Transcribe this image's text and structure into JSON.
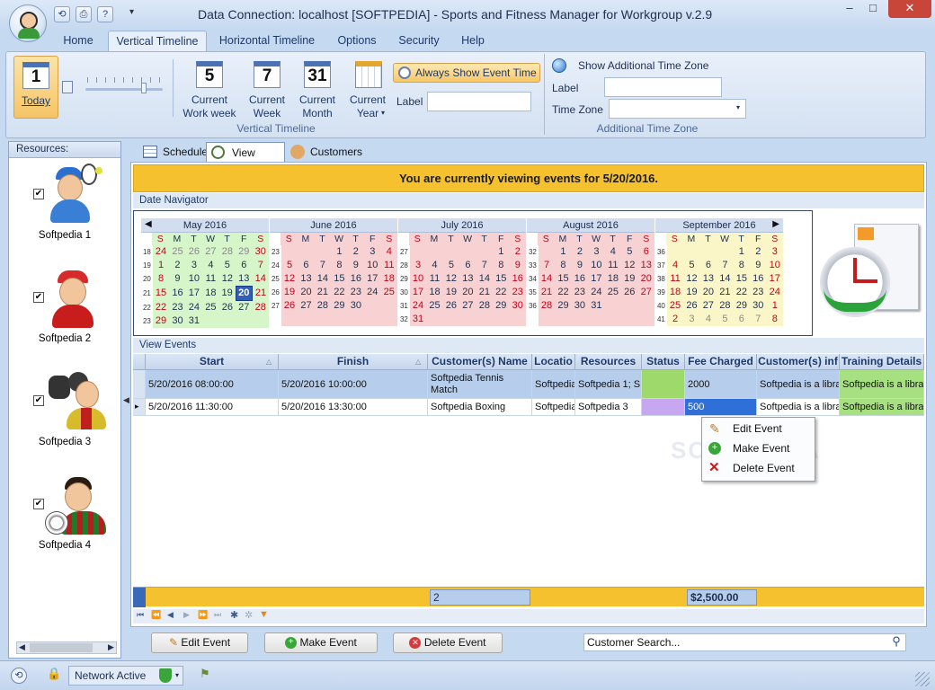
{
  "window": {
    "title": "Data Connection: localhost [SOFTPEDIA] - Sports and Fitness Manager for Workgroup v.2.9",
    "minimize": "–",
    "maximize": "□",
    "close": "✕"
  },
  "ribbon": {
    "tabs": [
      "Home",
      "Vertical Timeline",
      "Horizontal Timeline",
      "Options",
      "Security",
      "Help"
    ],
    "active_tab": "Vertical Timeline",
    "vertical_timeline": {
      "today": {
        "icon_text": "1",
        "label": "Today"
      },
      "current_work_week": {
        "icon_text": "5",
        "label_line1": "Current",
        "label_line2": "Work week"
      },
      "current_week": {
        "icon_text": "7",
        "label_line1": "Current",
        "label_line2": "Week"
      },
      "current_month": {
        "icon_text": "31",
        "label_line1": "Current",
        "label_line2": "Month"
      },
      "current_year": {
        "label_line1": "Current",
        "label_line2": "Year"
      },
      "always_show_event_time": "Always Show Event Time",
      "label_field": {
        "label": "Label",
        "value": ""
      },
      "group_label": "Vertical Timeline"
    },
    "additional_time_zone": {
      "show_label": "Show Additional Time Zone",
      "label_label": "Label",
      "label_value": "",
      "time_zone_label": "Time Zone",
      "time_zone_value": "",
      "group_label": "Additional Time Zone"
    }
  },
  "resources": {
    "header": "Resources:",
    "items": [
      {
        "name": "Softpedia 1",
        "checked": true
      },
      {
        "name": "Softpedia 2",
        "checked": true
      },
      {
        "name": "Softpedia 3",
        "checked": true
      },
      {
        "name": "Softpedia 4",
        "checked": true
      }
    ]
  },
  "content_tabs": [
    "Scheduler",
    "View Events",
    "Customers"
  ],
  "active_content_tab": "View Events",
  "banner": "You are currently viewing events for 5/20/2016.",
  "date_navigator": {
    "label": "Date Navigator",
    "dow": [
      "S",
      "M",
      "T",
      "W",
      "T",
      "F",
      "S"
    ],
    "months": [
      {
        "name": "May 2016",
        "watermark": "5",
        "bg": "#d6f5c8",
        "nav_prev": "◀",
        "weeks": [
          {
            "wk": "18",
            "days": [
              "24",
              "25",
              "26",
              "27",
              "28",
              "29",
              "30"
            ],
            "kinds": [
              "po",
              "po",
              "po",
              "po",
              "po",
              "po",
              "po"
            ]
          },
          {
            "wk": "19",
            "days": [
              "1",
              "2",
              "3",
              "4",
              "5",
              "6",
              "7"
            ]
          },
          {
            "wk": "20",
            "days": [
              "8",
              "9",
              "10",
              "11",
              "12",
              "13",
              "14"
            ]
          },
          {
            "wk": "21",
            "days": [
              "15",
              "16",
              "17",
              "18",
              "19",
              "20",
              "21"
            ],
            "selected": "20"
          },
          {
            "wk": "22",
            "days": [
              "22",
              "23",
              "24",
              "25",
              "26",
              "27",
              "28"
            ]
          },
          {
            "wk": "23",
            "days": [
              "29",
              "30",
              "31",
              "",
              "",
              "",
              ""
            ]
          }
        ]
      },
      {
        "name": "June 2016",
        "watermark": "6",
        "bg": "#f8d2d2",
        "weeks": [
          {
            "wk": "23",
            "days": [
              "",
              "",
              "",
              "1",
              "2",
              "3",
              "4"
            ]
          },
          {
            "wk": "24",
            "days": [
              "5",
              "6",
              "7",
              "8",
              "9",
              "10",
              "11"
            ]
          },
          {
            "wk": "25",
            "days": [
              "12",
              "13",
              "14",
              "15",
              "16",
              "17",
              "18"
            ]
          },
          {
            "wk": "26",
            "days": [
              "19",
              "20",
              "21",
              "22",
              "23",
              "24",
              "25"
            ]
          },
          {
            "wk": "27",
            "days": [
              "26",
              "27",
              "28",
              "29",
              "30",
              "",
              ""
            ]
          },
          {
            "wk": "",
            "days": [
              "",
              "",
              "",
              "",
              "",
              "",
              ""
            ]
          }
        ]
      },
      {
        "name": "July 2016",
        "watermark": "7",
        "bg": "#f8d2d2",
        "weeks": [
          {
            "wk": "27",
            "days": [
              "",
              "",
              "",
              "",
              "",
              "1",
              "2"
            ]
          },
          {
            "wk": "28",
            "days": [
              "3",
              "4",
              "5",
              "6",
              "7",
              "8",
              "9"
            ]
          },
          {
            "wk": "29",
            "days": [
              "10",
              "11",
              "12",
              "13",
              "14",
              "15",
              "16"
            ]
          },
          {
            "wk": "30",
            "days": [
              "17",
              "18",
              "19",
              "20",
              "21",
              "22",
              "23"
            ]
          },
          {
            "wk": "31",
            "days": [
              "24",
              "25",
              "26",
              "27",
              "28",
              "29",
              "30"
            ]
          },
          {
            "wk": "32",
            "days": [
              "31",
              "",
              "",
              "",
              "",
              "",
              ""
            ]
          }
        ]
      },
      {
        "name": "August 2016",
        "watermark": "8",
        "bg": "#f8d2d2",
        "weeks": [
          {
            "wk": "32",
            "days": [
              "",
              "1",
              "2",
              "3",
              "4",
              "5",
              "6"
            ]
          },
          {
            "wk": "33",
            "days": [
              "7",
              "8",
              "9",
              "10",
              "11",
              "12",
              "13"
            ]
          },
          {
            "wk": "34",
            "days": [
              "14",
              "15",
              "16",
              "17",
              "18",
              "19",
              "20"
            ]
          },
          {
            "wk": "35",
            "days": [
              "21",
              "22",
              "23",
              "24",
              "25",
              "26",
              "27"
            ]
          },
          {
            "wk": "36",
            "days": [
              "28",
              "29",
              "30",
              "31",
              "",
              "",
              ""
            ]
          },
          {
            "wk": "",
            "days": [
              "",
              "",
              "",
              "",
              "",
              "",
              ""
            ]
          }
        ]
      },
      {
        "name": "September 2016",
        "watermark": "9",
        "bg": "#fbf6c8",
        "nav_next": "▶",
        "weeks": [
          {
            "wk": "36",
            "days": [
              "",
              "",
              "",
              "",
              "1",
              "2",
              "3"
            ]
          },
          {
            "wk": "37",
            "days": [
              "4",
              "5",
              "6",
              "7",
              "8",
              "9",
              "10"
            ]
          },
          {
            "wk": "38",
            "days": [
              "11",
              "12",
              "13",
              "14",
              "15",
              "16",
              "17"
            ]
          },
          {
            "wk": "39",
            "days": [
              "18",
              "19",
              "20",
              "21",
              "22",
              "23",
              "24"
            ]
          },
          {
            "wk": "40",
            "days": [
              "25",
              "26",
              "27",
              "28",
              "29",
              "30",
              "1"
            ],
            "kinds": [
              "",
              "",
              "",
              "",
              "",
              "",
              "po"
            ]
          },
          {
            "wk": "41",
            "days": [
              "2",
              "3",
              "4",
              "5",
              "6",
              "7",
              "8"
            ],
            "kinds": [
              "po",
              "po",
              "po",
              "po",
              "po",
              "po",
              "po"
            ]
          }
        ]
      }
    ]
  },
  "view_events": {
    "label": "View Events",
    "columns": [
      "Start",
      "Finish",
      "Customer(s) Name",
      "Locatio",
      "Resources",
      "Status",
      "Fee Charged",
      "Customer(s) inf",
      "Training Details"
    ],
    "rows": [
      {
        "start": "5/20/2016 08:00:00",
        "finish": "5/20/2016 10:00:00",
        "customer_line1": "Softpedia Tennis",
        "customer_line2": "Match",
        "location": "Softpedia",
        "resources": "Softpedia 1; S",
        "status_color": "#9ed96b",
        "fee": "2000",
        "info": "Softpedia is a libra",
        "training": "Softpedia is a librar"
      },
      {
        "start": "5/20/2016 11:30:00",
        "finish": "5/20/2016 13:30:00",
        "customer_line1": "Softpedia Boxing",
        "customer_line2": "",
        "location": "Softpedia",
        "resources": "Softpedia 3",
        "status_color": "#c7a8f0",
        "fee": "500",
        "info": "Softpedia is a libra",
        "training": "Softpedia is a librar"
      }
    ],
    "summary_count": "2",
    "summary_fee": "$2,500.00"
  },
  "context_menu": [
    "Edit Event",
    "Make Event",
    "Delete Event"
  ],
  "bottom_buttons": {
    "edit": "Edit Event",
    "make": "Make Event",
    "delete": "Delete Event"
  },
  "customer_search": {
    "placeholder": "Customer Search...",
    "value": "Customer Search..."
  },
  "statusbar": {
    "network": "Network Active"
  },
  "watermark": "SOFTPEDIA"
}
